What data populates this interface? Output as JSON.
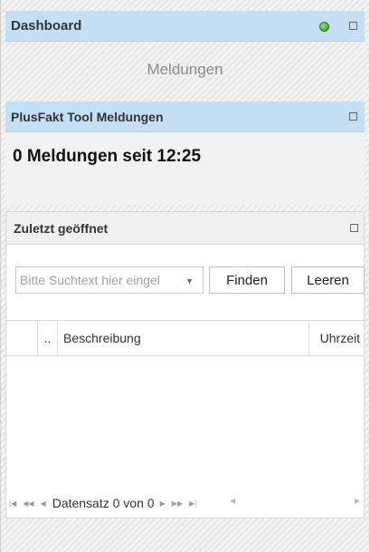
{
  "dashboard": {
    "title": "Dashboard"
  },
  "meldungen_tab": {
    "label": "Meldungen"
  },
  "plusfakt_panel": {
    "title": "PlusFakt Tool Meldungen",
    "count_text": "0 Meldungen seit 12:25"
  },
  "recent_panel": {
    "title": "Zuletzt geöffnet",
    "search": {
      "placeholder": "Bitte Suchtext hier eingeben",
      "visible_text": "Bitte Suchtext hier eingel",
      "value": ""
    },
    "find_label": "Finden",
    "clear_label": "Leeren",
    "grid": {
      "columns": [
        "",
        "..",
        "Beschreibung",
        "Uhrzeit"
      ],
      "rows": []
    },
    "pager": {
      "label": "Datensatz 0 von 0"
    }
  },
  "colors": {
    "header_blue": "#c5dff4",
    "status_green": "#2c9a1e"
  },
  "icons": [
    "status-online-icon",
    "maximize-icon",
    "dropdown-arrow-icon",
    "first-page-icon",
    "prev-page-icon",
    "next-page-icon",
    "last-page-icon"
  ]
}
